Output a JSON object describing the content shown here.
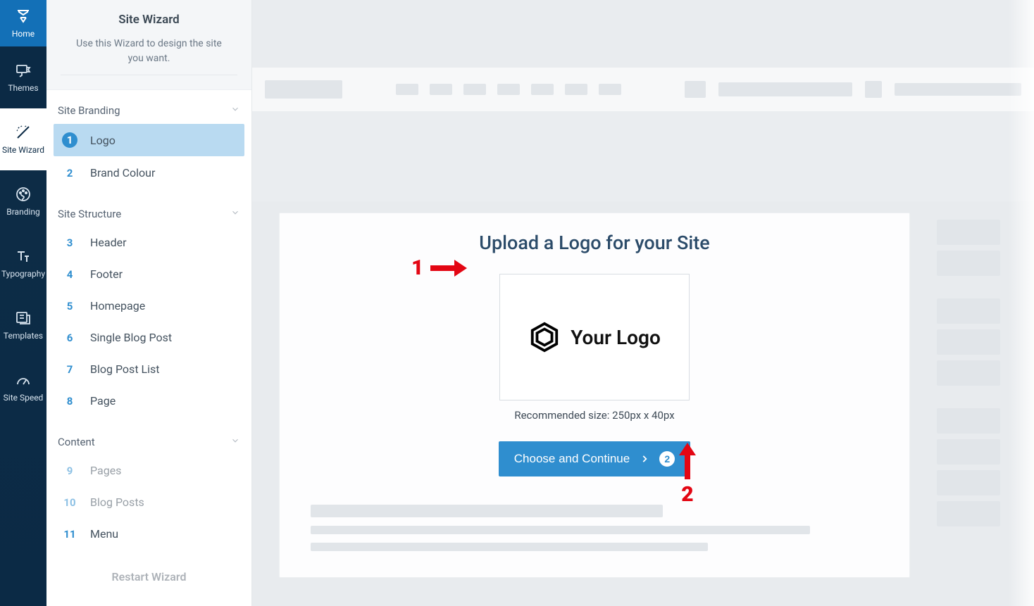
{
  "rail": {
    "home": "Home",
    "themes": "Themes",
    "site_wizard": "Site Wizard",
    "branding": "Branding",
    "typography": "Typography",
    "templates": "Templates",
    "site_speed": "Site Speed"
  },
  "wizard": {
    "title": "Site Wizard",
    "subtitle": "Use this Wizard to design the site you want.",
    "sections": {
      "branding": {
        "title": "Site Branding",
        "items": [
          {
            "n": "1",
            "label": "Logo"
          },
          {
            "n": "2",
            "label": "Brand Colour"
          }
        ]
      },
      "structure": {
        "title": "Site Structure",
        "items": [
          {
            "n": "3",
            "label": "Header"
          },
          {
            "n": "4",
            "label": "Footer"
          },
          {
            "n": "5",
            "label": "Homepage"
          },
          {
            "n": "6",
            "label": "Single Blog Post"
          },
          {
            "n": "7",
            "label": "Blog Post List"
          },
          {
            "n": "8",
            "label": "Page"
          }
        ]
      },
      "content": {
        "title": "Content",
        "items": [
          {
            "n": "9",
            "label": "Pages"
          },
          {
            "n": "10",
            "label": "Blog Posts"
          },
          {
            "n": "11",
            "label": "Menu"
          }
        ]
      }
    },
    "restart": "Restart Wizard"
  },
  "main": {
    "upload_title": "Upload a Logo for your Site",
    "logo_placeholder_text": "Your Logo",
    "recommended": "Recommended size: 250px x 40px",
    "cta_label": "Choose and Continue",
    "cta_next_step": "2"
  },
  "annotations": {
    "a1": "1",
    "a2": "2"
  },
  "colors": {
    "accent": "#2f8ecf",
    "rail_home": "#1370b7",
    "annotation": "#e30613"
  }
}
